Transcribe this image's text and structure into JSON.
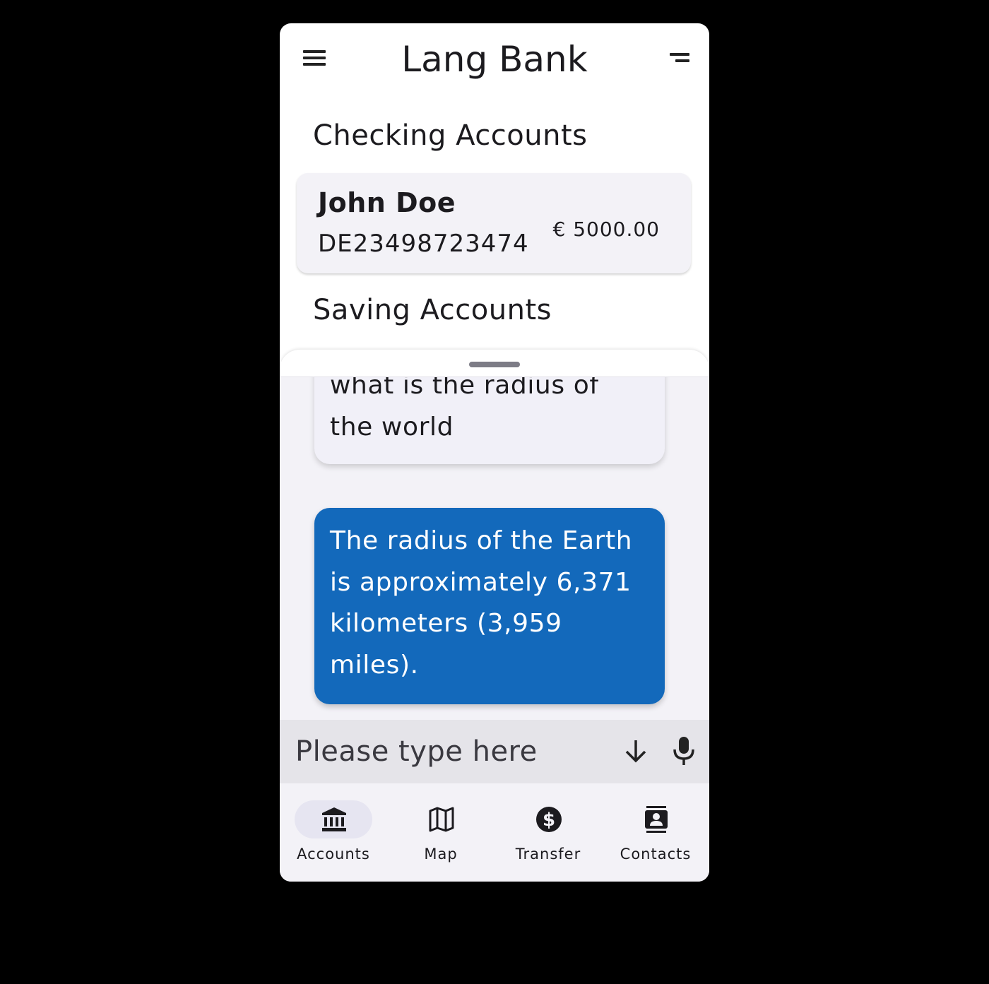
{
  "app": {
    "title": "Lang Bank"
  },
  "sections": {
    "checking_title": "Checking Accounts",
    "saving_title": "Saving Accounts"
  },
  "checking_accounts": [
    {
      "name": "John Doe",
      "iban": "DE23498723474",
      "balance": "€ 5000.00"
    }
  ],
  "chat": {
    "messages": [
      {
        "role": "user",
        "text": "what is the radius of the world"
      },
      {
        "role": "assistant",
        "text": "The radius of the Earth is approximately 6,371 kilometers (3,959 miles)."
      }
    ],
    "input_placeholder": "Please type here",
    "send_icon": "arrow-down-icon",
    "voice_icon": "microphone-icon"
  },
  "nav": {
    "items": [
      {
        "label": "Accounts",
        "icon": "bank-icon",
        "selected": true
      },
      {
        "label": "Map",
        "icon": "map-icon",
        "selected": false
      },
      {
        "label": "Transfer",
        "icon": "dollar-circle-icon",
        "selected": false
      },
      {
        "label": "Contacts",
        "icon": "contacts-icon",
        "selected": false
      }
    ]
  },
  "colors": {
    "assistant_bubble": "#1369bb",
    "sheet_background": "#f3f2f7",
    "nav_selected_pill": "#e6e5f1"
  }
}
